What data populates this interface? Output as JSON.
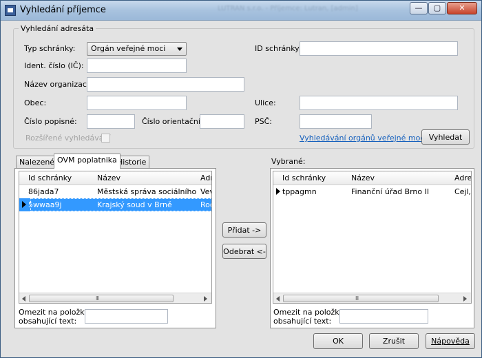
{
  "window": {
    "title": "Vyhledání příjemce",
    "blurred_title": "LUTRAN s.r.o. - Příjemce: Lutran, [admin]"
  },
  "controls": {
    "minimize": "—",
    "maximize": "▢",
    "close": "✕"
  },
  "search": {
    "legend": "Vyhledání adresáta",
    "type_label": "Typ schránky:",
    "type_value": "Orgán veřejné moci",
    "ico_label": "Ident. číslo (IČ):",
    "ico_value": "",
    "org_label": "Název organizace:",
    "org_value": "",
    "obec_label": "Obec:",
    "obec_value": "",
    "cp_label": "Číslo popisné:",
    "cp_value": "",
    "co_label": "Číslo  orientační:",
    "co_value": "",
    "id_label": "ID schránky:",
    "id_value": "",
    "ulice_label": "Ulice:",
    "ulice_value": "",
    "psc_label": "PSČ:",
    "psc_value": "",
    "extended_label": "Rozšířené vyhledávání",
    "extended_checked": false,
    "ovm_link": "Vyhledávání orgánů veřejné moci",
    "search_button": "Vyhledat"
  },
  "tabs": [
    {
      "label": "Nalezené",
      "active": false
    },
    {
      "label": "OVM poplatnika",
      "active": true
    },
    {
      "label": "Historie",
      "active": false
    }
  ],
  "left_grid": {
    "columns": [
      "Id schránky",
      "Název",
      "Adr"
    ],
    "rows": [
      {
        "id": "86jada7",
        "name": "Městská správa sociálního z...",
        "addr": "Vev",
        "selected": false
      },
      {
        "id": "5wwaa9j",
        "name": "Krajský soud v Brně",
        "addr": "Roo",
        "selected": true
      }
    ],
    "scroll_glyph": "III"
  },
  "left_filter": {
    "label_line1": "Omezit na položky",
    "label_line2": "obsahující text:",
    "value": ""
  },
  "transfer": {
    "add": "Přidat ->",
    "remove": "Odebrat <-"
  },
  "selected_section": {
    "label": "Vybrané:"
  },
  "right_grid": {
    "columns": [
      "Id schránky",
      "Název",
      "Adres"
    ],
    "rows": [
      {
        "id": "tppagmn",
        "name": "Finanční úřad Brno II",
        "addr": "Cejl,",
        "selected": false
      }
    ],
    "scroll_glyph": "III"
  },
  "right_filter": {
    "label_line1": "Omezit na položky",
    "label_line2": "obsahující text:",
    "value": ""
  },
  "footer": {
    "ok": "OK",
    "cancel": "Zrušit",
    "help": "Nápověda"
  },
  "colors": {
    "selection": "#3399ff",
    "link": "#1560bd",
    "window_bg": "#e3e3e3"
  }
}
